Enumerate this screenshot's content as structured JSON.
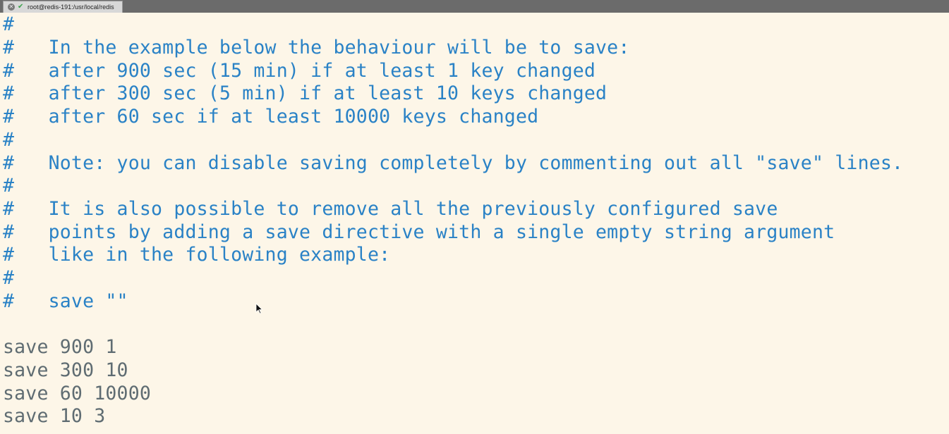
{
  "window": {
    "tab_title": "root@redis-191:/usr/local/redis"
  },
  "editor": {
    "comment_color": "#2a82c6",
    "code_color": "#5f6c72",
    "background_color": "#fdf6e8",
    "lines": [
      "#",
      "#   In the example below the behaviour will be to save:",
      "#   after 900 sec (15 min) if at least 1 key changed",
      "#   after 300 sec (5 min) if at least 10 keys changed",
      "#   after 60 sec if at least 10000 keys changed",
      "#",
      "#   Note: you can disable saving completely by commenting out all \"save\" lines.",
      "#",
      "#   It is also possible to remove all the previously configured save",
      "#   points by adding a save directive with a single empty string argument",
      "#   like in the following example:",
      "#",
      "#   save \"\"",
      "",
      "save 900 1",
      "save 300 10",
      "save 60 10000",
      "save 10 3"
    ]
  }
}
